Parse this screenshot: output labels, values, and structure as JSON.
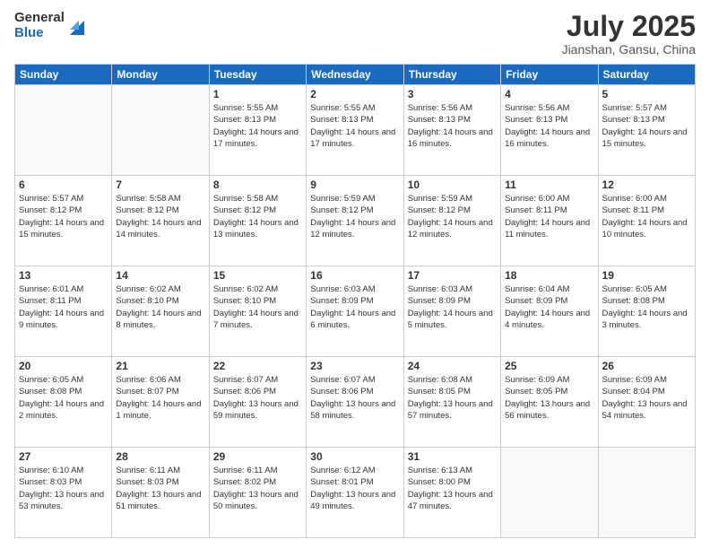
{
  "header": {
    "logo_general": "General",
    "logo_blue": "Blue",
    "month_title": "July 2025",
    "location": "Jianshan, Gansu, China"
  },
  "weekdays": [
    "Sunday",
    "Monday",
    "Tuesday",
    "Wednesday",
    "Thursday",
    "Friday",
    "Saturday"
  ],
  "weeks": [
    [
      {
        "day": "",
        "info": ""
      },
      {
        "day": "",
        "info": ""
      },
      {
        "day": "1",
        "info": "Sunrise: 5:55 AM\nSunset: 8:13 PM\nDaylight: 14 hours and 17 minutes."
      },
      {
        "day": "2",
        "info": "Sunrise: 5:55 AM\nSunset: 8:13 PM\nDaylight: 14 hours and 17 minutes."
      },
      {
        "day": "3",
        "info": "Sunrise: 5:56 AM\nSunset: 8:13 PM\nDaylight: 14 hours and 16 minutes."
      },
      {
        "day": "4",
        "info": "Sunrise: 5:56 AM\nSunset: 8:13 PM\nDaylight: 14 hours and 16 minutes."
      },
      {
        "day": "5",
        "info": "Sunrise: 5:57 AM\nSunset: 8:13 PM\nDaylight: 14 hours and 15 minutes."
      }
    ],
    [
      {
        "day": "6",
        "info": "Sunrise: 5:57 AM\nSunset: 8:12 PM\nDaylight: 14 hours and 15 minutes."
      },
      {
        "day": "7",
        "info": "Sunrise: 5:58 AM\nSunset: 8:12 PM\nDaylight: 14 hours and 14 minutes."
      },
      {
        "day": "8",
        "info": "Sunrise: 5:58 AM\nSunset: 8:12 PM\nDaylight: 14 hours and 13 minutes."
      },
      {
        "day": "9",
        "info": "Sunrise: 5:59 AM\nSunset: 8:12 PM\nDaylight: 14 hours and 12 minutes."
      },
      {
        "day": "10",
        "info": "Sunrise: 5:59 AM\nSunset: 8:12 PM\nDaylight: 14 hours and 12 minutes."
      },
      {
        "day": "11",
        "info": "Sunrise: 6:00 AM\nSunset: 8:11 PM\nDaylight: 14 hours and 11 minutes."
      },
      {
        "day": "12",
        "info": "Sunrise: 6:00 AM\nSunset: 8:11 PM\nDaylight: 14 hours and 10 minutes."
      }
    ],
    [
      {
        "day": "13",
        "info": "Sunrise: 6:01 AM\nSunset: 8:11 PM\nDaylight: 14 hours and 9 minutes."
      },
      {
        "day": "14",
        "info": "Sunrise: 6:02 AM\nSunset: 8:10 PM\nDaylight: 14 hours and 8 minutes."
      },
      {
        "day": "15",
        "info": "Sunrise: 6:02 AM\nSunset: 8:10 PM\nDaylight: 14 hours and 7 minutes."
      },
      {
        "day": "16",
        "info": "Sunrise: 6:03 AM\nSunset: 8:09 PM\nDaylight: 14 hours and 6 minutes."
      },
      {
        "day": "17",
        "info": "Sunrise: 6:03 AM\nSunset: 8:09 PM\nDaylight: 14 hours and 5 minutes."
      },
      {
        "day": "18",
        "info": "Sunrise: 6:04 AM\nSunset: 8:09 PM\nDaylight: 14 hours and 4 minutes."
      },
      {
        "day": "19",
        "info": "Sunrise: 6:05 AM\nSunset: 8:08 PM\nDaylight: 14 hours and 3 minutes."
      }
    ],
    [
      {
        "day": "20",
        "info": "Sunrise: 6:05 AM\nSunset: 8:08 PM\nDaylight: 14 hours and 2 minutes."
      },
      {
        "day": "21",
        "info": "Sunrise: 6:06 AM\nSunset: 8:07 PM\nDaylight: 14 hours and 1 minute."
      },
      {
        "day": "22",
        "info": "Sunrise: 6:07 AM\nSunset: 8:06 PM\nDaylight: 13 hours and 59 minutes."
      },
      {
        "day": "23",
        "info": "Sunrise: 6:07 AM\nSunset: 8:06 PM\nDaylight: 13 hours and 58 minutes."
      },
      {
        "day": "24",
        "info": "Sunrise: 6:08 AM\nSunset: 8:05 PM\nDaylight: 13 hours and 57 minutes."
      },
      {
        "day": "25",
        "info": "Sunrise: 6:09 AM\nSunset: 8:05 PM\nDaylight: 13 hours and 56 minutes."
      },
      {
        "day": "26",
        "info": "Sunrise: 6:09 AM\nSunset: 8:04 PM\nDaylight: 13 hours and 54 minutes."
      }
    ],
    [
      {
        "day": "27",
        "info": "Sunrise: 6:10 AM\nSunset: 8:03 PM\nDaylight: 13 hours and 53 minutes."
      },
      {
        "day": "28",
        "info": "Sunrise: 6:11 AM\nSunset: 8:03 PM\nDaylight: 13 hours and 51 minutes."
      },
      {
        "day": "29",
        "info": "Sunrise: 6:11 AM\nSunset: 8:02 PM\nDaylight: 13 hours and 50 minutes."
      },
      {
        "day": "30",
        "info": "Sunrise: 6:12 AM\nSunset: 8:01 PM\nDaylight: 13 hours and 49 minutes."
      },
      {
        "day": "31",
        "info": "Sunrise: 6:13 AM\nSunset: 8:00 PM\nDaylight: 13 hours and 47 minutes."
      },
      {
        "day": "",
        "info": ""
      },
      {
        "day": "",
        "info": ""
      }
    ]
  ]
}
